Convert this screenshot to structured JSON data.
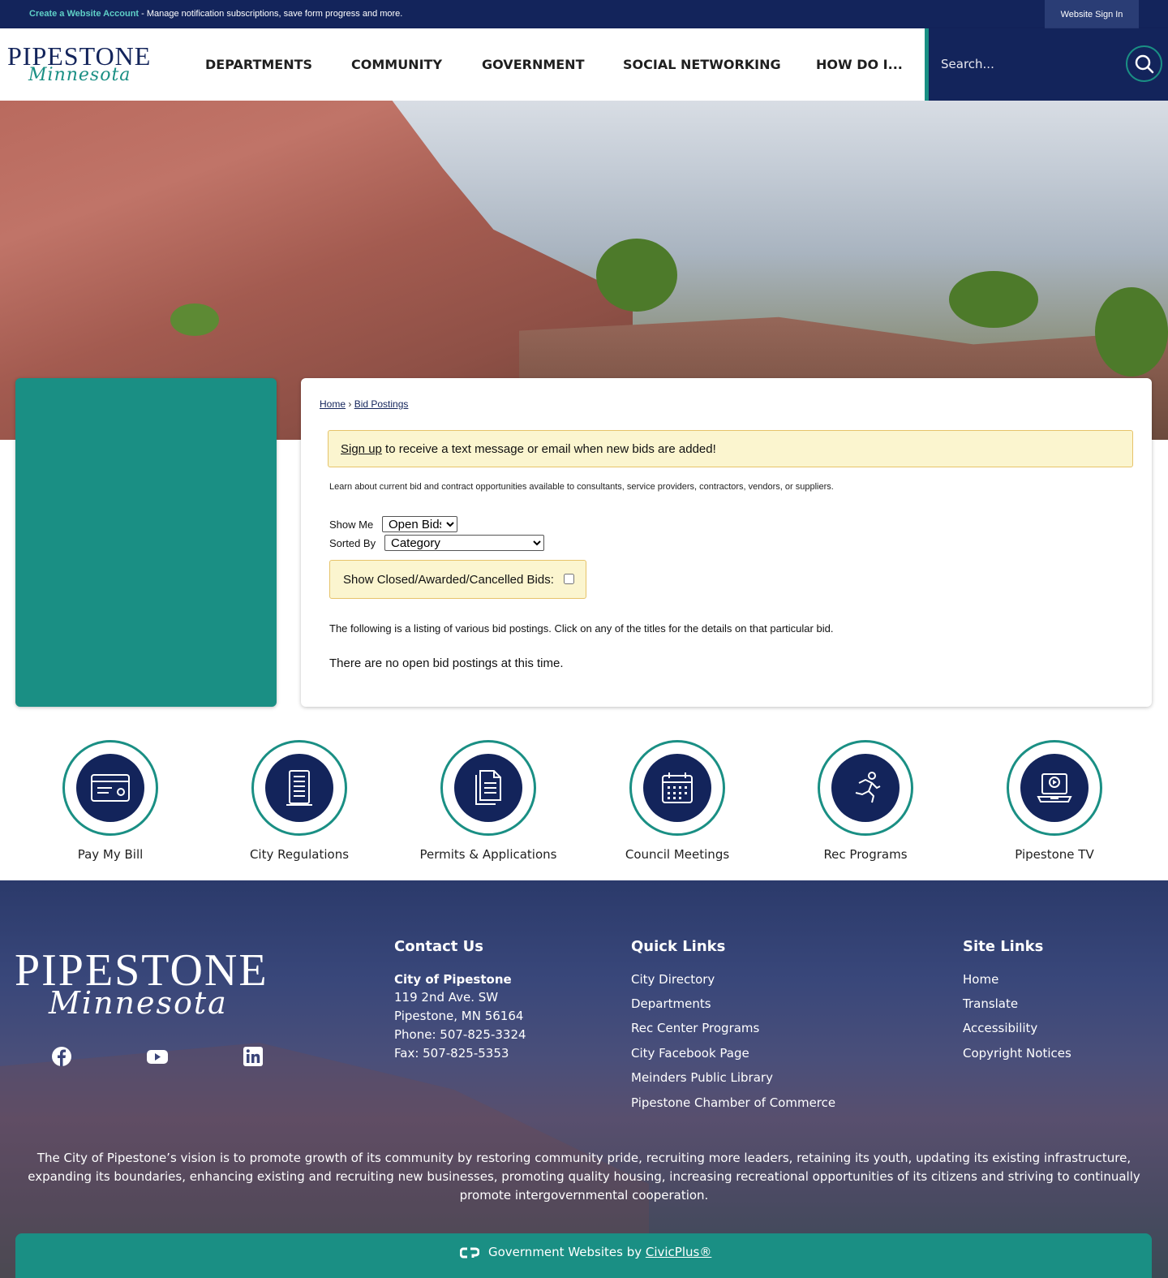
{
  "topbar": {
    "create_account": "Create a Website Account",
    "create_desc": " - Manage notification subscriptions, save form progress and more.",
    "sign_in": "Website Sign In"
  },
  "header": {
    "logo_line1": "PIPESTONE",
    "logo_line2": "Minnesota",
    "nav": [
      "DEPARTMENTS",
      "COMMUNITY",
      "GOVERNMENT",
      "SOCIAL NETWORKING",
      "HOW DO I..."
    ],
    "search_placeholder": "Search..."
  },
  "breadcrumb": {
    "home": "Home",
    "sep": "›",
    "current": "Bid Postings"
  },
  "alert": {
    "link": "Sign up",
    "text": " to receive a text message or email when new bids are added!"
  },
  "learn_text": "Learn about current bid and contract opportunities available to consultants, service providers, contractors, vendors, or suppliers.",
  "filters": {
    "show_me_label": "Show Me",
    "show_me_value": "Open Bids",
    "sorted_by_label": "Sorted By",
    "sorted_by_value": "Category",
    "closed_label": "Show Closed/Awarded/Cancelled Bids:"
  },
  "listing_text": "The following is a listing of various bid postings. Click on any of the titles for the details on that particular bid.",
  "no_bids_text": "There are no open bid postings at this time.",
  "quick_links": [
    {
      "label": "Pay My Bill",
      "icon": "credit-card-icon"
    },
    {
      "label": "City Regulations",
      "icon": "document-list-icon"
    },
    {
      "label": "Permits & Applications",
      "icon": "documents-icon"
    },
    {
      "label": "Council Meetings",
      "icon": "calendar-icon"
    },
    {
      "label": "Rec Programs",
      "icon": "running-person-icon"
    },
    {
      "label": "Pipestone TV",
      "icon": "video-laptop-icon"
    }
  ],
  "footer": {
    "logo_line1": "PIPESTONE",
    "logo_line2": "Minnesota",
    "social": [
      "facebook-icon",
      "youtube-icon",
      "linkedin-icon"
    ],
    "contact_heading": "Contact Us",
    "contact_name": "City of Pipestone",
    "contact_lines": [
      "119 2nd Ave. SW",
      "Pipestone, MN  56164",
      "Phone: 507-825-3324",
      "Fax:  507-825-5353"
    ],
    "quick_heading": "Quick Links",
    "quick_links": [
      "City Directory",
      "Departments",
      "Rec Center Programs",
      "City Facebook Page",
      "Meinders Public Library",
      "Pipestone Chamber of Commerce"
    ],
    "site_heading": "Site Links",
    "site_links": [
      "Home",
      "Translate",
      "Accessibility",
      "Copyright Notices"
    ],
    "vision": "The City of Pipestone’s vision is to promote growth of its community by restoring community pride, recruiting more leaders, retaining its youth, updating its existing infrastructure, expanding its boundaries, enhancing existing and recruiting new businesses, promoting quality housing, increasing recreational opportunities of its citizens and striving to continually promote intergovernmental cooperation.",
    "civicplus_prefix": "Government Websites by ",
    "civicplus_link": "CivicPlus®"
  },
  "colors": {
    "navy": "#13245b",
    "teal": "#1a8f84",
    "alert_bg": "#fbf5cf"
  }
}
